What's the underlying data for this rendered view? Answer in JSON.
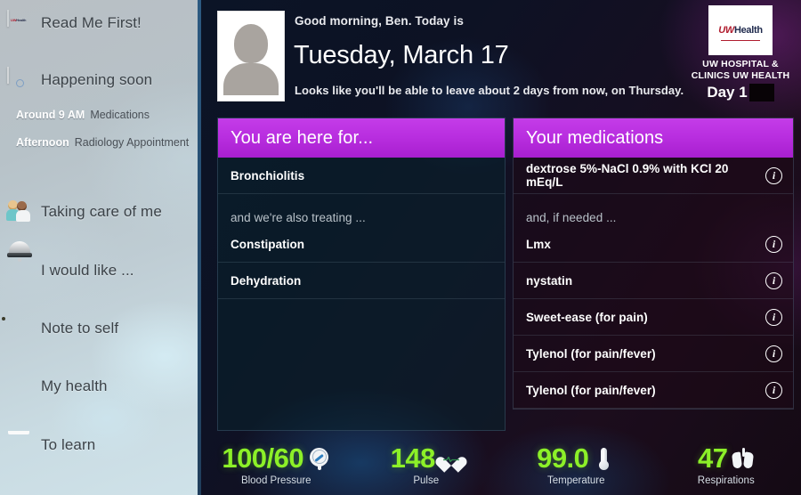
{
  "sidebar": {
    "items": [
      {
        "label": "Read Me First!",
        "icon": "uwhealth-card-icon"
      },
      {
        "label": "Happening soon",
        "icon": "calendar-icon"
      },
      {
        "label": "Taking care of me",
        "icon": "care-team-icon"
      },
      {
        "label": "I would like ...",
        "icon": "service-bell-icon"
      },
      {
        "label": "Note to self",
        "icon": "sticky-note-icon"
      },
      {
        "label": "My health",
        "icon": "document-icon"
      },
      {
        "label": "To learn",
        "icon": "book-icon"
      }
    ],
    "events": [
      {
        "when": "Around 9 AM",
        "what": "Medications"
      },
      {
        "when": "Afternoon",
        "what": "Radiology Appointment"
      }
    ]
  },
  "header": {
    "greeting": "Good morning, Ben. Today is",
    "date": "Tuesday, March 17",
    "discharge_note": "Looks like you'll be able to leave about 2 days from now, on Thursday.",
    "avatar_alt": "patient-photo-placeholder"
  },
  "brand": {
    "logo_uw": "UW",
    "logo_health": "Health",
    "organization": "UW HOSPITAL & CLINICS UW HEALTH",
    "day_label": "Day 1"
  },
  "conditions_card": {
    "title": "You are here for...",
    "primary": "Bronchiolitis",
    "secondary_label": "and we're also treating ...",
    "secondary": [
      "Constipation",
      "Dehydration"
    ]
  },
  "medications_card": {
    "title": "Your medications",
    "scheduled": [
      {
        "name": "dextrose 5%-NaCl 0.9% with KCl 20 mEq/L",
        "info": "i"
      }
    ],
    "prn_label": "and, if needed ...",
    "prn": [
      {
        "name": "Lmx",
        "info": "i"
      },
      {
        "name": "nystatin",
        "info": "i"
      },
      {
        "name": "Sweet-ease (for pain)",
        "info": "i"
      },
      {
        "name": "Tylenol (for pain/fever)",
        "info": "i"
      },
      {
        "name": "Tylenol (for pain/fever)",
        "info": "i"
      }
    ]
  },
  "vitals": [
    {
      "value": "100/60",
      "name": "Blood Pressure",
      "icon": "gauge-icon"
    },
    {
      "value": "148",
      "name": "Pulse",
      "icon": "heart-pulse-icon"
    },
    {
      "value": "99.0",
      "name": "Temperature",
      "icon": "thermometer-icon"
    },
    {
      "value": "47",
      "name": "Respirations",
      "icon": "lungs-icon"
    }
  ],
  "colors": {
    "accent_purple": "#b92fe0",
    "vital_green": "#8cf028",
    "brand_red": "#b01c2e",
    "brand_navy": "#1f2a4d"
  }
}
